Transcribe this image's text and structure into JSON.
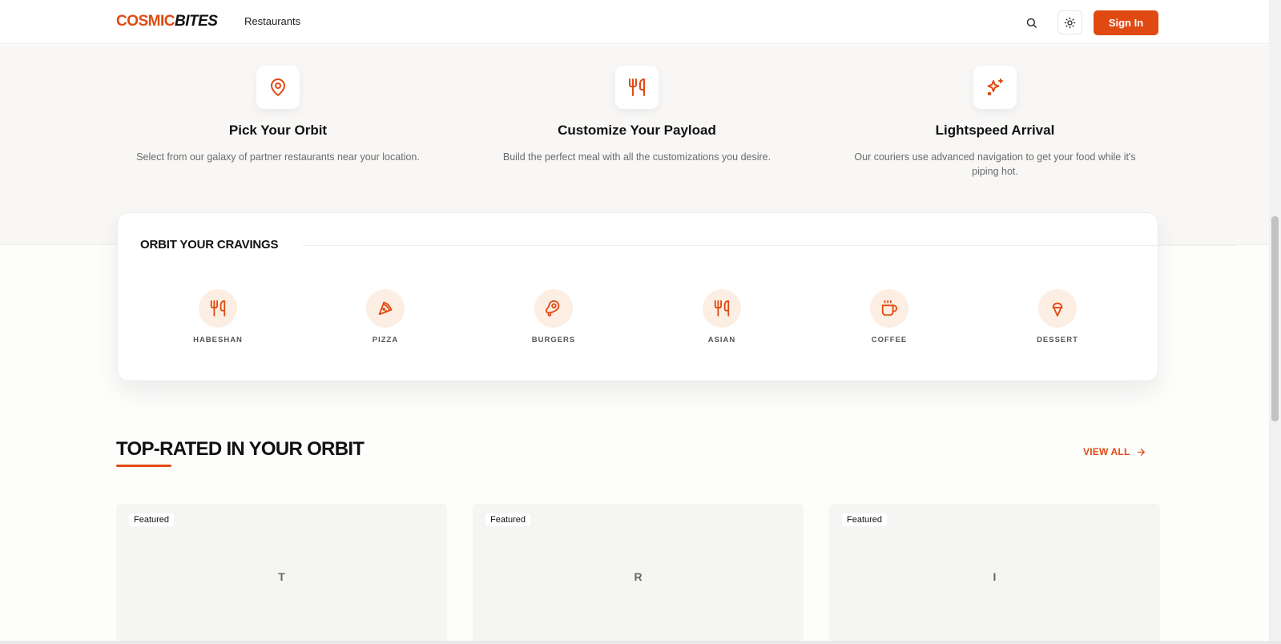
{
  "header": {
    "logo_part1": "COSMIC",
    "logo_part2": "BITES",
    "nav_restaurants": "Restaurants",
    "sign_in": "Sign In",
    "icons": {
      "search": "search-icon",
      "theme": "sun-icon"
    }
  },
  "steps": [
    {
      "title": "Pick Your Orbit",
      "desc": "Select from our galaxy of partner restaurants near your location.",
      "icon": "map-pin-icon"
    },
    {
      "title": "Customize Your Payload",
      "desc": "Build the perfect meal with all the customizations you desire.",
      "icon": "utensils-icon"
    },
    {
      "title": "Lightspeed Arrival",
      "desc": "Our couriers use advanced navigation to get your food while it's piping hot.",
      "icon": "sparkles-icon"
    }
  ],
  "cravings": {
    "title": "ORBIT YOUR CRAVINGS",
    "categories": [
      {
        "label": "HABESHAN",
        "icon": "utensils-icon"
      },
      {
        "label": "PIZZA",
        "icon": "pizza-icon"
      },
      {
        "label": "BURGERS",
        "icon": "beef-icon"
      },
      {
        "label": "ASIAN",
        "icon": "utensils-icon"
      },
      {
        "label": "COFFEE",
        "icon": "coffee-icon"
      },
      {
        "label": "DESSERT",
        "icon": "ice-cream-icon"
      }
    ]
  },
  "top_rated": {
    "title": "TOP-RATED IN YOUR ORBIT",
    "view_all": "VIEW ALL",
    "cards": [
      {
        "badge": "Featured",
        "initial": "T"
      },
      {
        "badge": "Featured",
        "initial": "R"
      },
      {
        "badge": "Featured",
        "initial": "I"
      }
    ]
  },
  "colors": {
    "accent": "#e04a12",
    "accent_soft": "#fdeee3",
    "section_bg": "#f8f7f6"
  }
}
